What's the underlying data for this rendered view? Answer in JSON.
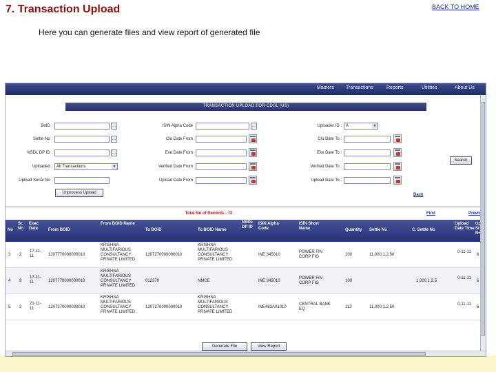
{
  "slide": {
    "title": "7.  Transaction Upload",
    "back_link": "BACK TO HOME",
    "subtitle": "Here you can generate files and view report of generated file"
  },
  "app": {
    "menu": [
      "Masters",
      "Transactions",
      "Reports",
      "Utilities",
      "About Us"
    ],
    "screen_title": "TRANSACTION UPLOAD FOR CDSL (US)",
    "form": {
      "boid_label": "BoID :",
      "settle_no_label": "Settle No :",
      "nsdl_dp_id_label": "NSDL DP ID :",
      "uploaded_label": "Uploaded :",
      "uploaded_value": "All Transactions",
      "upload_serial_label": "Upload Serial No :",
      "isin_alpha_label": "ISIN Alpha Code",
      "clo_date_from_label": "Clo Date From",
      "exe_date_from_label": "Exe Date From",
      "verified_date_from_label": "Verified Date From",
      "upload_date_from_label": "Upload Date From",
      "uploader_id_label": "Uploader ID :",
      "uploader_id_value": "A",
      "clo_date_to_label": "Clo Date To :",
      "exe_date_to_label": "Exe Date To :",
      "verified_date_to_label": "Verified Date To :",
      "upload_date_to_label": "Upload Date To :",
      "lookup_glyph": "...",
      "search_button": "Search",
      "unprocess_button": "Unprocess Upload",
      "back_link": "Back"
    },
    "records_label": "Total No of Records : 72",
    "first_link": "First",
    "prev_link": "Previous",
    "columns": [
      "No",
      "Sr. No",
      "Exec Date",
      "From BOID",
      "From BOID Name",
      "To BOID",
      "To BOID Name",
      "NSDL DP ID",
      "ISIN Alpha Code",
      "ISIN Short Name",
      "Quantity",
      "Settle No",
      "C. Settle No",
      "Upload Date Time",
      "Upload Sr. No"
    ],
    "rows": [
      {
        "no": "3",
        "sr": "2",
        "exec": "17-11-11",
        "from_boid": "1207770000000010",
        "from_name": "KRISHNA MULTIFARIOUS CONSULTANCY PRIVATE LIMITED",
        "to_boid": "1207270000000010",
        "to_name": "KRISHNA MULTIFARIOUS CONSULTANCY PRIVATE LIMITED",
        "nsdl": "",
        "isin": "INE 345010",
        "isin_name": "POWER FIN CORP FIG",
        "qty": "100",
        "settle": "11,000,1,2,50",
        "csettle": "",
        "upload_dt": "0-11-11",
        "upload_sr": "6"
      },
      {
        "no": "4",
        "sr": "3",
        "exec": "17-11-11",
        "from_boid": "1207770000000010",
        "from_name": "KRISHNA MULTIFARIOUS CONSULTANCY PRIVATE LIMITED",
        "to_boid": "012370",
        "to_name": "NMCE",
        "nsdl": "",
        "isin": "INE 345010",
        "isin_name": "POWER FIN CORP FIG",
        "qty": "100",
        "settle": "",
        "csettle": "1,000,1,2,5",
        "upload_dt": "0-11-11",
        "upload_sr": "6"
      },
      {
        "no": "5",
        "sr": "2",
        "exec": "21-11-11",
        "from_boid": "1207270000000010",
        "from_name": "KRISHNA MULTIFARIOUS CONSULTANCY PRIVATE LIMITED",
        "to_boid": "1207270000000010",
        "to_name": "KRISHNA MULTIFARIOUS CONSULTANCY PRIVATE LIMITED",
        "nsdl": "",
        "isin": "INE483A01010",
        "isin_name": "CENTRAL BANK EQ",
        "qty": "113",
        "settle": "11,000,1,2,50",
        "csettle": "",
        "upload_dt": "0-11-11",
        "upload_sr": "6"
      }
    ],
    "generate_button": "Generate File",
    "view_report_button": "View Report"
  }
}
